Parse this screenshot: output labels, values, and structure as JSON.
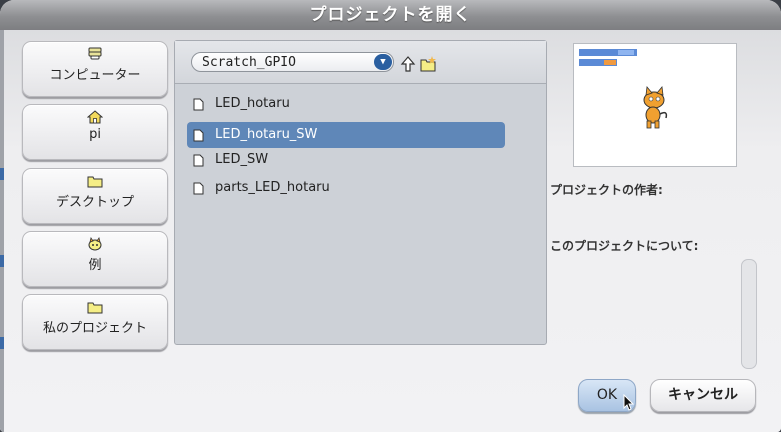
{
  "dialog": {
    "title": "プロジェクトを開く"
  },
  "sidebar": {
    "items": [
      {
        "label": "コンピューター",
        "icon": "drive-icon"
      },
      {
        "label": "pi",
        "icon": "home-icon"
      },
      {
        "label": "デスクトップ",
        "icon": "folder-icon"
      },
      {
        "label": "例",
        "icon": "cat-icon"
      },
      {
        "label": "私のプロジェクト",
        "icon": "folder-icon"
      }
    ]
  },
  "browser": {
    "current_folder": "Scratch_GPIO",
    "files": [
      {
        "name": "LED_hotaru",
        "selected": false
      },
      {
        "name": "LED_hotaru_SW",
        "selected": true
      },
      {
        "name": "LED_SW",
        "selected": false
      },
      {
        "name": "parts_LED_hotaru",
        "selected": false
      }
    ]
  },
  "preview": {
    "author_label": "プロジェクトの作者:",
    "about_label": "このプロジェクトについて:"
  },
  "actions": {
    "ok": "OK",
    "cancel": "キャンセル"
  },
  "colors": {
    "selection": "#5f87b8",
    "accent": "#2a5fa0",
    "title_bar": "#8e8f92"
  }
}
